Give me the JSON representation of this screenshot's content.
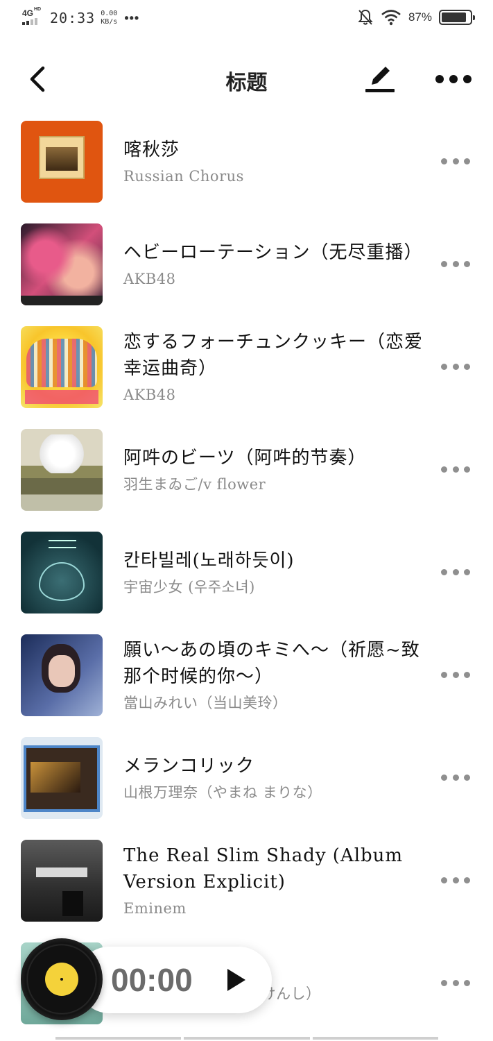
{
  "status_bar": {
    "network": "4G",
    "network_hd": "HD",
    "time": "20:33",
    "speed_value": "0.00",
    "speed_unit": "KB/s",
    "more": "•••",
    "battery_pct": "87%",
    "battery_level": 0.87
  },
  "header": {
    "title": "标题",
    "back_icon": "chevron-left-icon",
    "edit_icon": "pen-underline-icon",
    "more_icon": "more-horizontal-icon"
  },
  "songs": [
    {
      "title": "喀秋莎",
      "artist": "Russian Chorus"
    },
    {
      "title": "ヘビーローテーション（无尽重播）",
      "artist": "AKB48"
    },
    {
      "title": "恋するフォーチュンクッキー（恋爱幸运曲奇）",
      "artist": "AKB48"
    },
    {
      "title": "阿吽のビーツ（阿吽的节奏）",
      "artist": "羽生まゐご/v flower"
    },
    {
      "title": "칸타빌레(노래하듯이)",
      "artist": "宇宙少女 (우주소녀)"
    },
    {
      "title": "願い～あの頃のキミへ～（祈愿~致那个时候的你～）",
      "artist": "當山みれい（当山美玲）"
    },
    {
      "title": "メランコリック",
      "artist": "山根万理奈（やまね まりな）"
    },
    {
      "title": "The Real Slim Shady (Album Version Explicit)",
      "artist": "Eminem"
    },
    {
      "title": "",
      "artist": "げ けんし）"
    }
  ],
  "player": {
    "time": "00:00",
    "play_icon": "play-icon",
    "disc_icon": "vinyl-disc-icon"
  }
}
